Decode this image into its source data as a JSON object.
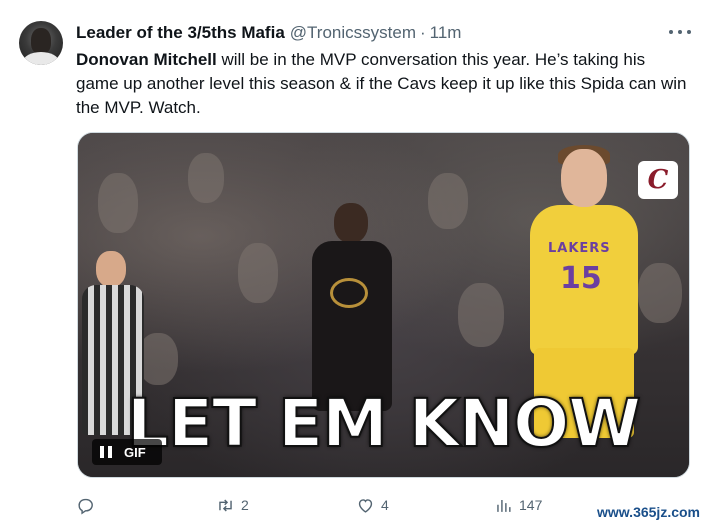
{
  "tweet": {
    "author_name": "Leader of the 3/5ths Mafia",
    "handle": "@Tronicssystem",
    "separator": "·",
    "time": "11m",
    "text_bold": "Donovan Mitchell",
    "text_rest": " will be in the MVP conversation this year. He’s taking his game up another level this season & if the Cavs keep it up like this Spida can win the MVP. Watch."
  },
  "media": {
    "caption": "LET EM KNOW",
    "gif_label": "GIF",
    "jersey_team": "LAKERS",
    "jersey_number": "15",
    "badge_letter": "C"
  },
  "actions": {
    "reply_count": "",
    "retweet_count": "2",
    "like_count": "4",
    "views_count": "147"
  },
  "watermark": "www.365jz.com",
  "icons": {
    "reply": "reply-icon",
    "retweet": "retweet-icon",
    "like": "heart-icon",
    "views": "views-icon",
    "more": "more-icon",
    "pause": "pause-icon"
  }
}
